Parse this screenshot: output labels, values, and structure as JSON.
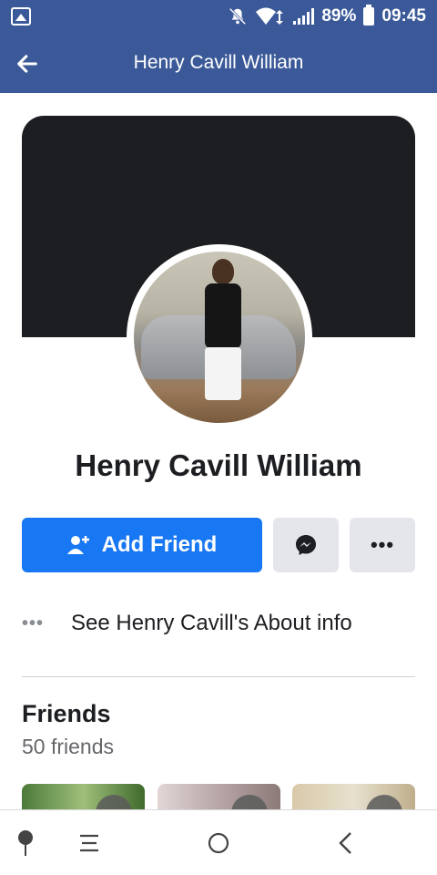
{
  "status_bar": {
    "battery": "89%",
    "time": "09:45"
  },
  "header": {
    "title": "Henry Cavill William"
  },
  "profile": {
    "name": "Henry Cavill William",
    "add_friend_label": "Add Friend",
    "about_text": "See Henry Cavill's About info"
  },
  "friends": {
    "title": "Friends",
    "count": "50 friends"
  },
  "colors": {
    "header_bg": "#3b5998",
    "primary_button": "#1877f2",
    "secondary_button": "#e4e6eb",
    "cover": "#1c1e21"
  }
}
